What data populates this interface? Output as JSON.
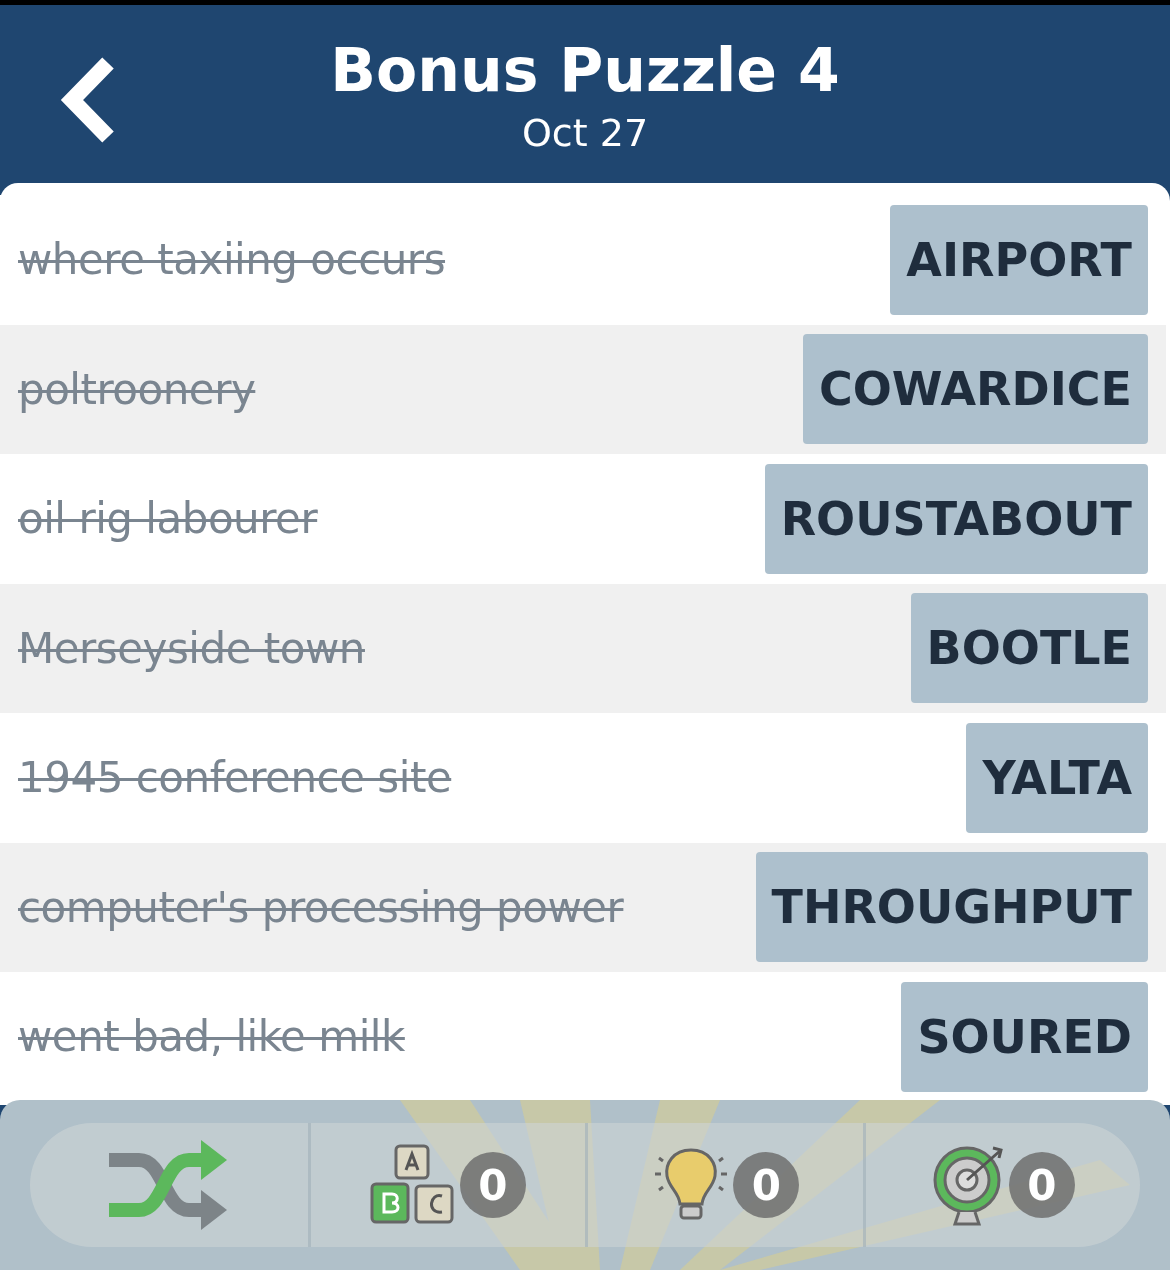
{
  "header": {
    "title": "Bonus Puzzle 4",
    "subtitle": "Oct 27"
  },
  "clues": [
    {
      "clue": "where taxiing occurs",
      "answer": "AIRPORT",
      "solved": true
    },
    {
      "clue": "poltroonery",
      "answer": "COWARDICE",
      "solved": true
    },
    {
      "clue": "oil rig labourer",
      "answer": "ROUSTABOUT",
      "solved": true
    },
    {
      "clue": "Merseyside town",
      "answer": "BOOTLE",
      "solved": true
    },
    {
      "clue": "1945 conference site",
      "answer": "YALTA",
      "solved": true
    },
    {
      "clue": "computer's processing power",
      "answer": "THROUGHPUT",
      "solved": true
    },
    {
      "clue": "went bad, like milk",
      "answer": "SOURED",
      "solved": true
    }
  ],
  "toolbar": [
    {
      "kind": "shuffle"
    },
    {
      "kind": "letters",
      "count": "0"
    },
    {
      "kind": "hint",
      "count": "0"
    },
    {
      "kind": "target",
      "count": "0"
    }
  ]
}
